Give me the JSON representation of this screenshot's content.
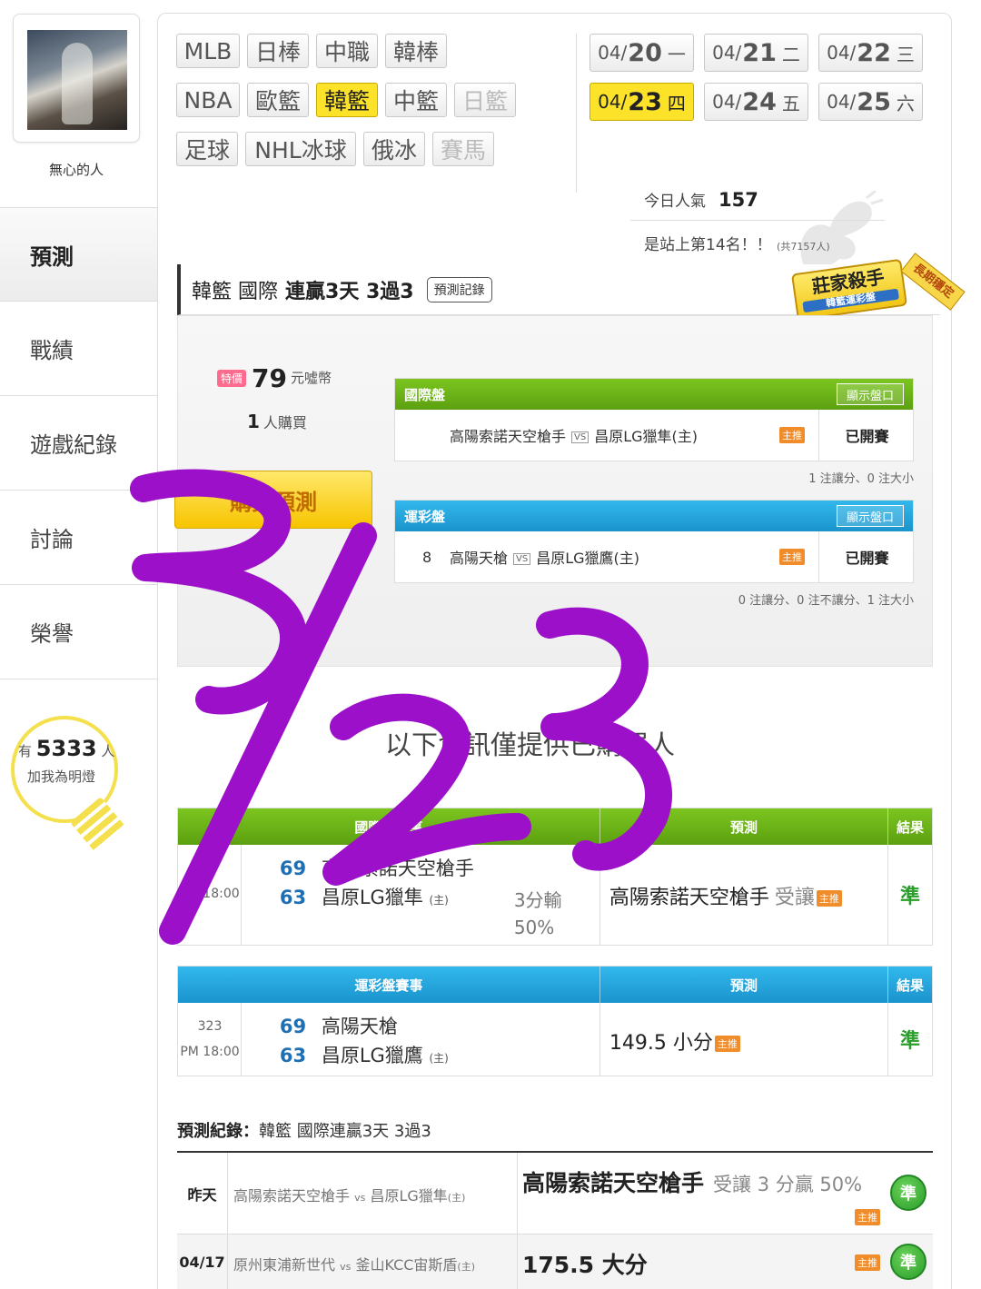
{
  "user": {
    "name": "無心的人"
  },
  "sidebar": {
    "items": [
      {
        "label": "預測",
        "active": true
      },
      {
        "label": "戰績"
      },
      {
        "label": "遊戲紀錄"
      },
      {
        "label": "討論"
      },
      {
        "label": "榮譽"
      }
    ],
    "lamp": {
      "prefix": "有",
      "count": "5333",
      "suffix": "人",
      "action": "加我為明燈"
    }
  },
  "sports": {
    "row1": [
      "MLB",
      "日棒",
      "中職",
      "韓棒"
    ],
    "row2": [
      "NBA",
      "歐籃",
      "韓籃",
      "中籃",
      "日籃"
    ],
    "row3": [
      "足球",
      "NHL冰球",
      "俄冰",
      "賽馬"
    ],
    "active": "韓籃"
  },
  "dates": [
    {
      "md": "04/",
      "d": "20",
      "w": "一"
    },
    {
      "md": "04/",
      "d": "21",
      "w": "二"
    },
    {
      "md": "04/",
      "d": "22",
      "w": "三"
    },
    {
      "md": "04/",
      "d": "23",
      "w": "四",
      "active": true
    },
    {
      "md": "04/",
      "d": "24",
      "w": "五"
    },
    {
      "md": "04/",
      "d": "25",
      "w": "六"
    }
  ],
  "stats": {
    "popularity_label": "今日人氣",
    "popularity_value": "157",
    "rank_text": "是站上第14名！！",
    "rank_total": "(共7157人)"
  },
  "card": {
    "league": "韓籃",
    "market": "國際",
    "streak": "連贏3天 3過3",
    "record_button": "預測記錄",
    "badge_title": "莊家殺手",
    "badge_sub": "韓籃運彩盤",
    "badge_tag": "長期穩定"
  },
  "offer": {
    "tag": "特價",
    "price": "79",
    "unit": "元噓幣",
    "buyers": "1",
    "buyers_label": "人購買",
    "buy_button": "購買預測"
  },
  "mini_tables": [
    {
      "title": "國際盤",
      "show_button": "顯示盤口",
      "away": "高陽索諾天空槍手",
      "vs": "VS",
      "home": "昌原LG獵隼(主)",
      "tag": "主推",
      "status": "已開賽",
      "note": "1 注讓分、0 注大小"
    },
    {
      "title": "運彩盤",
      "show_button": "顯示盤口",
      "prefix": "8",
      "away": "高陽天槍",
      "vs": "VS",
      "home": "昌原LG獵鷹(主)",
      "tag": "主推",
      "status": "已開賽",
      "note": "0 注讓分、0 注不讓分、1 注大小"
    }
  ],
  "info_only_text": "以下資訊僅提供已購買人",
  "results": [
    {
      "header": {
        "game": "國際盤賽事",
        "pred": "預測",
        "result": "結果"
      },
      "code": "",
      "time": "PM 18:00",
      "away_score": "69",
      "away": "高陽索諾天空槍手",
      "home_score": "63",
      "home": "昌原LG獵隼",
      "home_tag": "(主)",
      "spread_line1": "3分輸",
      "spread_line2": "50%",
      "pred": "高陽索諾天空槍手",
      "pred_sub": "受讓",
      "tag": "主推",
      "result": "準"
    },
    {
      "header": {
        "game": "運彩盤賽事",
        "pred": "預測",
        "result": "結果"
      },
      "code": "323",
      "time": "PM 18:00",
      "away_score": "69",
      "away": "高陽天槍",
      "home_score": "63",
      "home": "昌原LG獵鷹",
      "home_tag": "(主)",
      "pred": "149.5 小分",
      "tag": "主推",
      "result": "準"
    }
  ],
  "record": {
    "title_label": "預測紀錄：",
    "title_text": "韓籃 國際連贏3天 3過3",
    "rows": [
      {
        "date": "昨天",
        "away": "高陽索諾天空槍手",
        "vs": "vs",
        "home": "昌原LG獵隼",
        "home_tag": "(主)",
        "pred": "高陽索諾天空槍手",
        "pred_sub": "受讓 3 分贏 50%",
        "tag": "主推",
        "result": "準"
      },
      {
        "date": "04/17",
        "away": "原州東浦新世代",
        "vs": "vs",
        "home": "釜山KCC宙斯盾",
        "home_tag": "(主)",
        "pred": "175.5 大分",
        "pred_sub": "",
        "tag": "主推",
        "result": "準"
      }
    ]
  },
  "handwriting": {
    "text": "3/23",
    "color": "#9b10c8"
  }
}
